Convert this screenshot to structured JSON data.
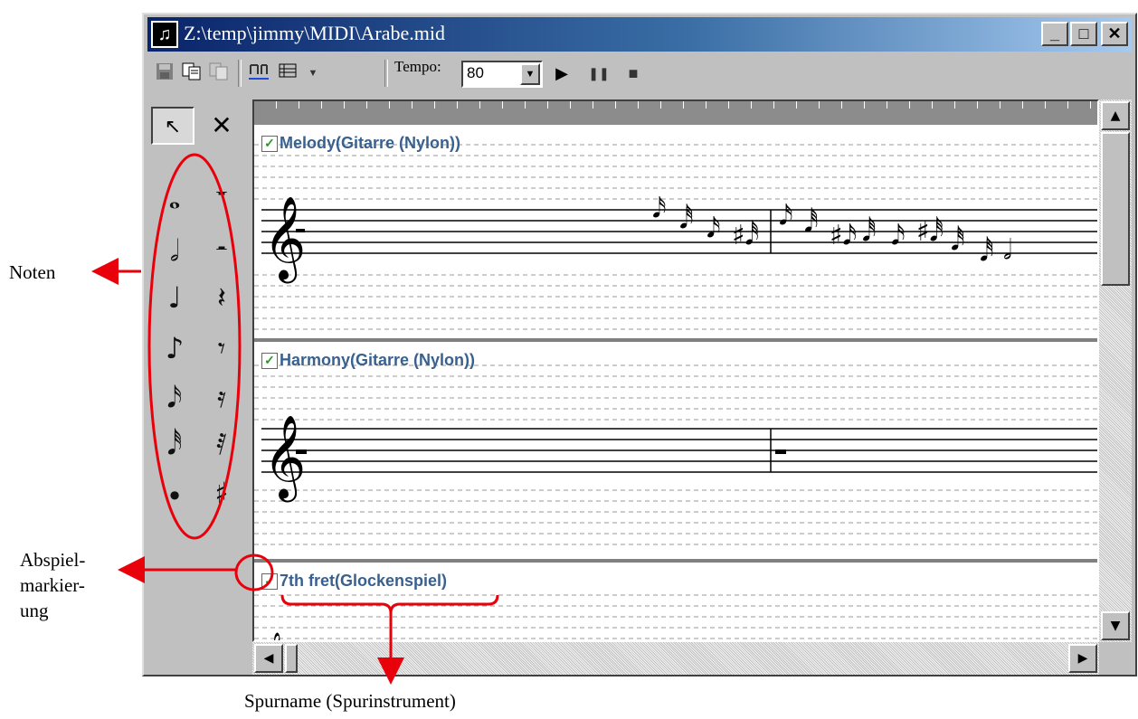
{
  "window": {
    "title": "Z:\\temp\\jimmy\\MIDI\\Arabe.mid",
    "app_icon": "music-note-icon",
    "controls": {
      "minimize": "_",
      "maximize": "□",
      "close": "×"
    }
  },
  "toolbar": {
    "tools": [
      "save-icon",
      "copy-icon",
      "paste-icon",
      "notation-icon",
      "tracklist-icon",
      "play-icon",
      "pause-icon",
      "stop-icon"
    ],
    "tempo_label": "Tempo:",
    "tempo_value": "80"
  },
  "palette": {
    "pointer": "pointer-icon",
    "delete": "×",
    "notes": [
      "whole-note",
      "half-note",
      "quarter-note",
      "eighth-note",
      "sixteenth-note",
      "thirtysecond-note",
      "dot"
    ],
    "rests": [
      "whole-rest",
      "half-rest",
      "quarter-rest",
      "eighth-rest",
      "sixteenth-rest",
      "thirtysecond-rest",
      "sharp"
    ]
  },
  "tracks": [
    {
      "name": "Melody(Gitarre (Nylon))",
      "checked": true
    },
    {
      "name": "Harmony(Gitarre (Nylon))",
      "checked": true
    },
    {
      "name": "7th fret(Glockenspiel)",
      "checked": true
    }
  ],
  "annotations": {
    "noten": "Noten",
    "abspiel_line1": "Abspiel-",
    "abspiel_line2": "markier-",
    "abspiel_line3": "ung",
    "spurname": "Spurname (Spurinstrument)"
  },
  "colors": {
    "annotation": "#e8000b",
    "track_title": "#39618f",
    "check": "#2a9a2a"
  }
}
